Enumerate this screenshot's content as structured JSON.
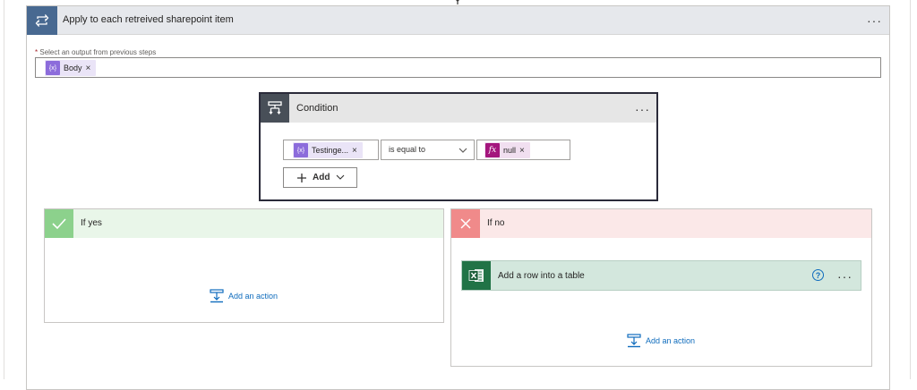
{
  "loop": {
    "title": "Apply to each retreived sharepoint item",
    "more_label": "···",
    "required_mark": "*",
    "field_label": "Select an output from previous steps",
    "output_token": {
      "label": "Body",
      "remove": "×",
      "icon": "expression-icon"
    }
  },
  "condition": {
    "title": "Condition",
    "more_label": "···",
    "left_token": {
      "label": "Testinge...",
      "remove": "×"
    },
    "operator": "is equal to",
    "right_token": {
      "icon_text": "fx",
      "label": "null",
      "remove": "×"
    },
    "add_label": "Add"
  },
  "branch_yes": {
    "title": "If yes",
    "add_action": "Add an action",
    "color": "#8cd18c"
  },
  "branch_no": {
    "title": "If no",
    "add_action": "Add an action",
    "color": "#f08a8a",
    "action": {
      "title": "Add a row into a table",
      "help": "?",
      "more_label": "···",
      "icon": "excel-icon"
    }
  },
  "colors": {
    "loop_icon": "#486991",
    "condition_icon": "#484f58",
    "excel": "#217346",
    "link": "#0f6cbd"
  }
}
